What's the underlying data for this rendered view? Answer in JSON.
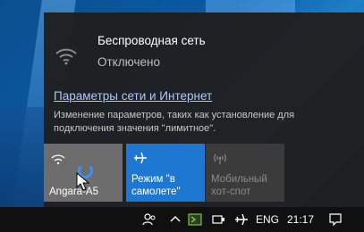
{
  "flyout": {
    "network": {
      "name": "Беспроводная сеть",
      "status": "Отключено"
    },
    "settings_link": "Параметры сети и Интернет",
    "settings_description": "Изменение параметров, таких как установление для подключения значения \"лимитное\".",
    "tiles": [
      {
        "label": "Angara-A5",
        "icon": "wifi-icon",
        "state": "connecting"
      },
      {
        "label": "Режим \"в\nсамолете\"",
        "icon": "airplane-icon",
        "state": "on"
      },
      {
        "label": "Мобильный\nхот-спот",
        "icon": "hotspot-icon",
        "state": "disabled"
      }
    ]
  },
  "taskbar": {
    "language": "ENG",
    "time": "21:17"
  },
  "colors": {
    "flyout_bg": "#1f1f1f",
    "accent": "#1e78d2",
    "link": "#a9c8ff"
  }
}
